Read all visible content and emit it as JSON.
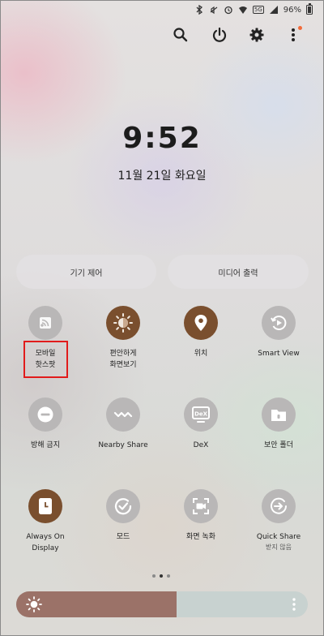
{
  "status_bar": {
    "network": "5G",
    "battery": "96%"
  },
  "top_actions": {
    "icons": [
      "search-icon",
      "power-icon",
      "settings-icon",
      "more-options-icon"
    ]
  },
  "lockscreen": {
    "time": "9:52",
    "date": "11월 21일 화요일"
  },
  "pills": {
    "device_control": "기기 제어",
    "media_output": "미디어 출력"
  },
  "tiles": {
    "row1": [
      {
        "label1": "모바일",
        "label2": "핫스팟",
        "icon": "hotspot-icon",
        "active": false
      },
      {
        "label1": "편안하게",
        "label2": "화면보기",
        "icon": "eye-comfort-icon",
        "active": true
      },
      {
        "label1": "위치",
        "label2": "",
        "icon": "location-icon",
        "active": true
      },
      {
        "label1": "Smart View",
        "label2": "",
        "icon": "smart-view-icon",
        "active": false
      }
    ],
    "row2": [
      {
        "label1": "방해 금지",
        "icon": "do-not-disturb-icon",
        "active": false
      },
      {
        "label1": "Nearby Share",
        "icon": "nearby-share-icon",
        "active": false
      },
      {
        "label1": "DeX",
        "icon": "dex-icon",
        "active": false
      },
      {
        "label1": "보안 폴더",
        "icon": "secure-folder-icon",
        "active": false
      }
    ],
    "row3": [
      {
        "label1": "Always On",
        "label2": "Display",
        "icon": "always-on-display-icon",
        "active": true
      },
      {
        "label1": "모드",
        "icon": "modes-icon",
        "active": false
      },
      {
        "label1": "화면 녹화",
        "icon": "screen-record-icon",
        "active": false
      },
      {
        "label1": "Quick Share",
        "sub": "받지 않음",
        "icon": "quick-share-icon",
        "active": false
      }
    ]
  },
  "brightness": {
    "level": 0.55
  },
  "page_indicator": {
    "count": 3,
    "active": 2
  },
  "colors": {
    "tile_active": "#7a4f2e",
    "tile_inactive": "#b9b7b7",
    "highlight": "#e11b1b",
    "brightness_fill": "#9b7268"
  }
}
